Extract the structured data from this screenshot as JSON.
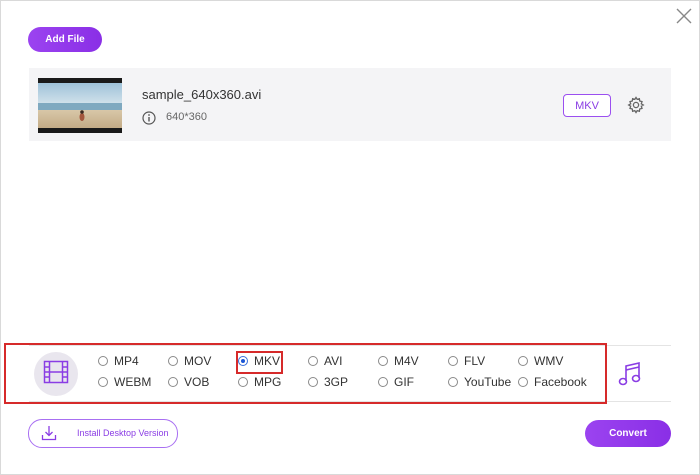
{
  "toolbar": {
    "add_file_label": "Add File"
  },
  "file": {
    "name": "sample_640x360.avi",
    "resolution": "640*360",
    "target_format": "MKV"
  },
  "icons": {
    "close": "close-icon",
    "info": "info-icon",
    "settings": "gear-icon",
    "video_tab": "film-icon",
    "audio_tab": "music-note-icon",
    "download": "download-icon"
  },
  "formats": {
    "row1": [
      "MP4",
      "MOV",
      "MKV",
      "AVI",
      "M4V",
      "FLV",
      "WMV"
    ],
    "row2": [
      "WEBM",
      "VOB",
      "MPG",
      "3GP",
      "GIF",
      "YouTube",
      "Facebook"
    ],
    "selected": "MKV"
  },
  "footer": {
    "install_label": "Install Desktop Version",
    "convert_label": "Convert"
  },
  "colors": {
    "accent": "#8a2fe6",
    "highlight": "#d62a2a",
    "radio_selected": "#1a56d6"
  }
}
